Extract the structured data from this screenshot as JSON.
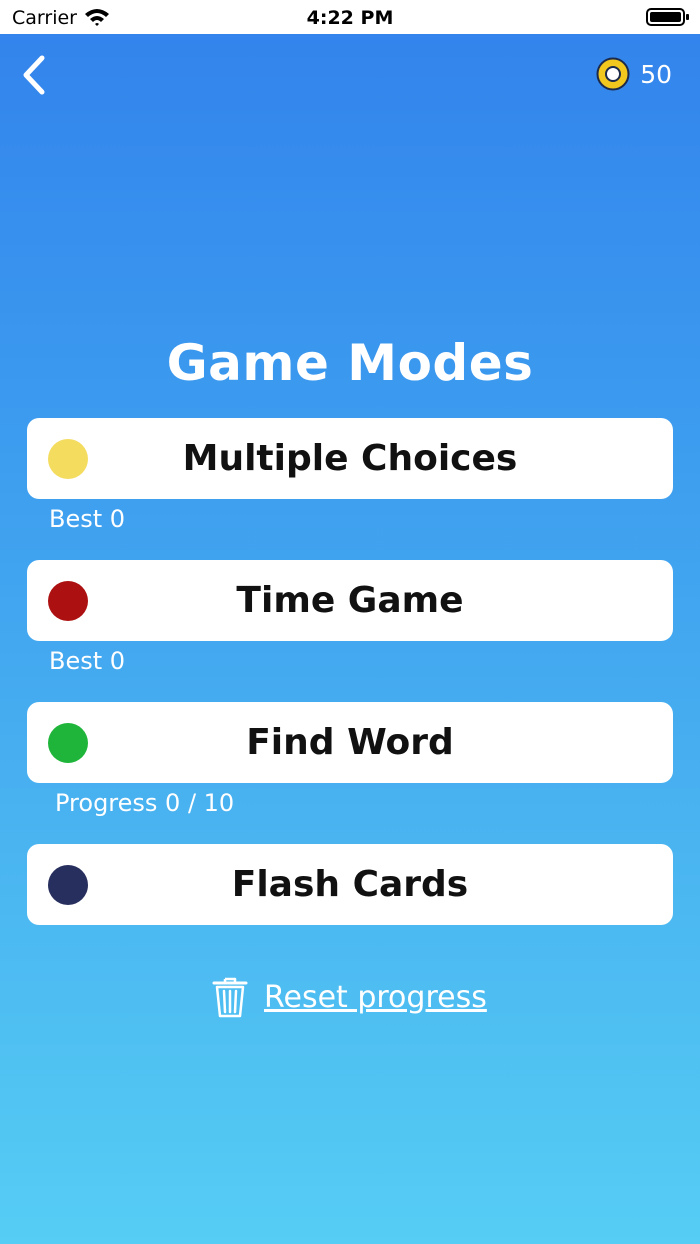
{
  "status_bar": {
    "carrier": "Carrier",
    "time": "4:22 PM"
  },
  "header": {
    "back_icon": "chevron-left-icon",
    "coin_icon": "coin-icon",
    "coins": "50"
  },
  "title": "Game Modes",
  "modes": [
    {
      "label": "Multiple Choices",
      "color": "#f4dc5f",
      "sub": "Best 0"
    },
    {
      "label": "Time Game",
      "color": "#ad1010",
      "sub": "Best 0"
    },
    {
      "label": "Find Word",
      "color": "#1fb53a",
      "sub": "Progress 0 / 10"
    },
    {
      "label": "Flash Cards",
      "color": "#272f5e",
      "sub": ""
    }
  ],
  "reset": {
    "icon": "trash-icon",
    "label": "Reset progress"
  },
  "colors": {
    "gradient_top": "#3282ec",
    "gradient_bottom": "#55cdf4",
    "coin": "#f2c81e"
  }
}
